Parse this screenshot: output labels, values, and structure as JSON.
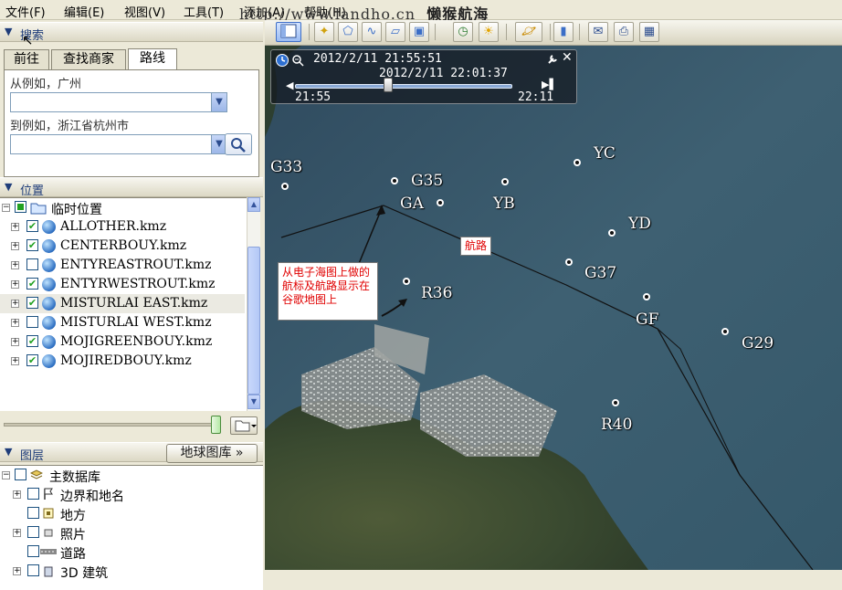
{
  "menu": {
    "items": [
      "文件(F)",
      "编辑(E)",
      "视图(V)",
      "工具(T)",
      "添加(A)",
      "帮助(H)"
    ],
    "watermark": "http://www.landho.cn",
    "watermark_brand": "懒猴航海"
  },
  "search": {
    "title": "搜索",
    "tabs": [
      "前往",
      "查找商家",
      "路线"
    ],
    "active_tab": "路线",
    "from_label": "从例如，广州",
    "to_label": "到例如，浙江省杭州市",
    "from_value": "",
    "to_value": ""
  },
  "places": {
    "title": "位置",
    "root": "临时位置",
    "items": [
      {
        "label": "ALLOTHER.kmz",
        "checked": true
      },
      {
        "label": "CENTERBOUY.kmz",
        "checked": true
      },
      {
        "label": "ENTYREASTROUT.kmz",
        "checked": false
      },
      {
        "label": "ENTYRWESTROUT.kmz",
        "checked": true
      },
      {
        "label": "MISTURLAI EAST.kmz",
        "checked": true
      },
      {
        "label": "MISTURLAI WEST.kmz",
        "checked": false
      },
      {
        "label": "MOJIGREENBOUY.kmz",
        "checked": true
      },
      {
        "label": "MOJIREDBOUY.kmz",
        "checked": true
      }
    ]
  },
  "layers": {
    "title": "图层",
    "library_button": "地球图库 »",
    "root": "主数据库",
    "items": [
      "边界和地名",
      "地方",
      "照片",
      "道路",
      "3D 建筑"
    ]
  },
  "time_slider": {
    "start_datetime": "2012/2/11    21:55:51",
    "current_datetime": "2012/2/11    22:01:37",
    "range_start": "21:55",
    "range_end": "22:11",
    "position_fraction": 0.43
  },
  "map": {
    "route_label": "航路",
    "annotation": "从电子海图上做的航标及航路显示在谷歌地图上",
    "buoys": [
      "G33",
      "G35",
      "GA",
      "YB",
      "YC",
      "YD",
      "G37",
      "R36",
      "GF",
      "G29",
      "R40"
    ]
  }
}
